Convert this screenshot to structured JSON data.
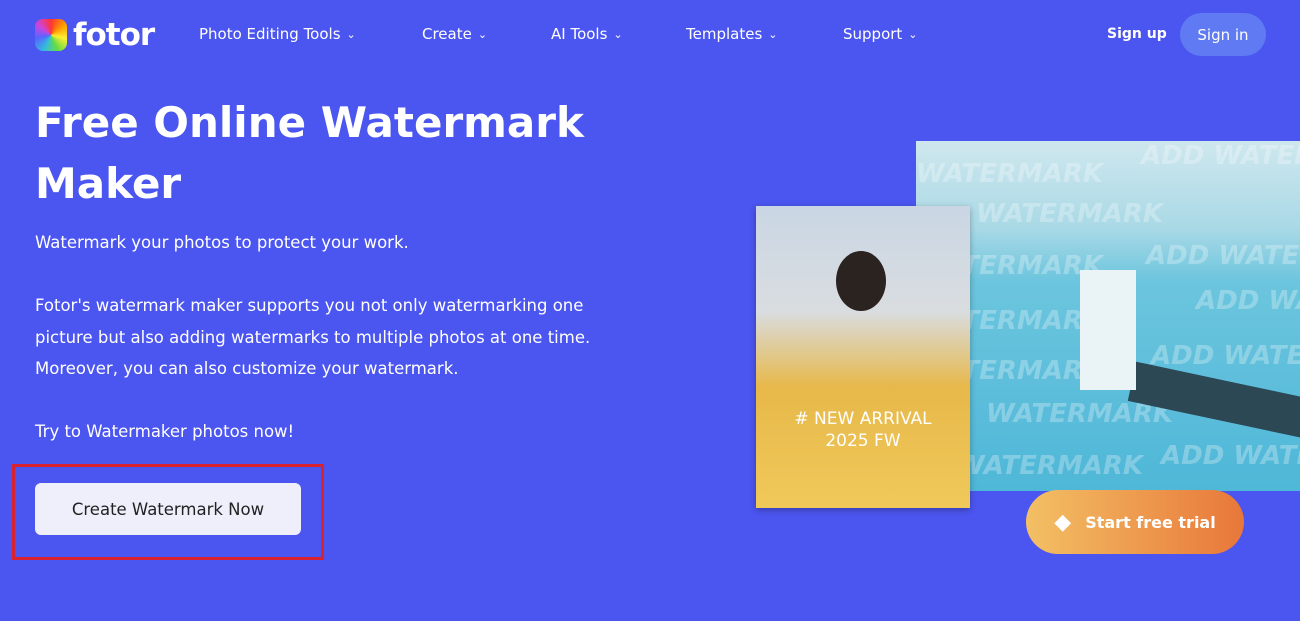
{
  "nav": {
    "logo": "fotor",
    "menu": [
      "Photo Editing Tools",
      "Create",
      "AI Tools",
      "Templates",
      "Support"
    ],
    "sign_up": "Sign up",
    "sign_in": "Sign in"
  },
  "hero": {
    "title": "Free Online Watermark Maker",
    "tagline": "Watermark your photos to protect your work.",
    "description": "Fotor's watermark maker supports you not only watermarking one picture but also adding watermarks to multiple photos at one time. Moreover, you can also customize your watermark.",
    "prompt": "Try to Watermaker photos now!",
    "cta": "Create Watermark Now"
  },
  "images": {
    "woman_caption_1": "# NEW ARRIVAL",
    "woman_caption_2": "2025 FW",
    "watermark_a": "WATERMARK",
    "watermark_b": "ADD WATERMARK"
  },
  "trial": {
    "label": "Start free trial",
    "icon": "diamond-icon"
  },
  "colors": {
    "background": "#4b55ef",
    "highlight": "#d8222f"
  }
}
